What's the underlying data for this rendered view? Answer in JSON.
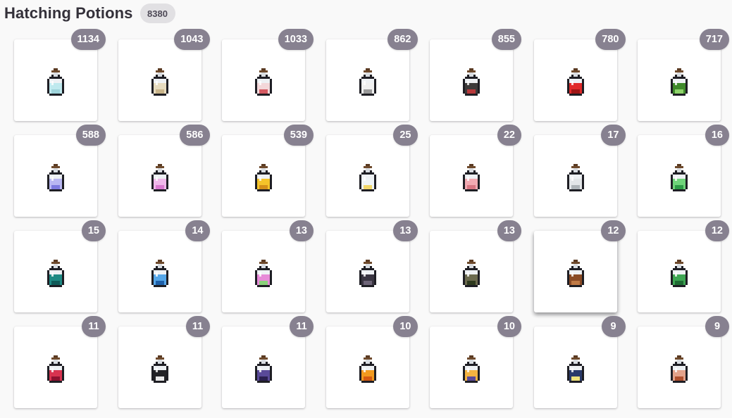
{
  "header": {
    "title": "Hatching Potions",
    "total": "8380"
  },
  "items": [
    {
      "count": "1134",
      "icon": "base-potion-icon",
      "color": "#bfe9ee",
      "accent": "#9ed3da"
    },
    {
      "count": "1043",
      "icon": "desert-potion-icon",
      "color": "#e6dbbf",
      "accent": "#c9b58a"
    },
    {
      "count": "1033",
      "icon": "red-white-potion-icon",
      "color": "#f3d7d9",
      "accent": "#d55a62"
    },
    {
      "count": "862",
      "icon": "skeleton-potion-icon",
      "color": "#f0f0f0",
      "accent": "#9a9a9a"
    },
    {
      "count": "855",
      "icon": "zombie-potion-icon",
      "color": "#3d3a3a",
      "accent": "#b8393b"
    },
    {
      "count": "780",
      "icon": "red-potion-icon",
      "color": "#e02a2a",
      "accent": "#9f1515"
    },
    {
      "count": "717",
      "icon": "cactus-potion-icon",
      "color": "#3f8a2b",
      "accent": "#8ed46a"
    },
    {
      "count": "588",
      "icon": "cotton-candy-blue-potion-icon",
      "color": "#b9b7f2",
      "accent": "#7e7ae0"
    },
    {
      "count": "586",
      "icon": "cotton-candy-pink-potion-icon",
      "color": "#f0b8ea",
      "accent": "#d97ad0"
    },
    {
      "count": "539",
      "icon": "golden-potion-icon",
      "color": "#f5c42a",
      "accent": "#d4901a"
    },
    {
      "count": "25",
      "icon": "rainbow-potion-icon",
      "color": "#eef4f6",
      "accent": "#f0d66a"
    },
    {
      "count": "22",
      "icon": "peppermint-potion-icon",
      "color": "#f2aab2",
      "accent": "#d87783"
    },
    {
      "count": "17",
      "icon": "frost-potion-icon",
      "color": "#e3e6e8",
      "accent": "#aeb4b8"
    },
    {
      "count": "16",
      "icon": "ghost-potion-icon",
      "color": "#6fd47a",
      "accent": "#2e9b47"
    },
    {
      "count": "15",
      "icon": "aquatic-potion-icon",
      "color": "#1e8a84",
      "accent": "#0f5a58"
    },
    {
      "count": "14",
      "icon": "celestial-potion-icon",
      "color": "#55a6e8",
      "accent": "#1d5fa8"
    },
    {
      "count": "13",
      "icon": "glass-potion-icon",
      "color": "#e78ad8",
      "accent": "#8ad27a"
    },
    {
      "count": "13",
      "icon": "shadow-potion-icon",
      "color": "#3a3542",
      "accent": "#6d6477"
    },
    {
      "count": "13",
      "icon": "moss-potion-icon",
      "color": "#6b6a4e",
      "accent": "#2e3a1e"
    },
    {
      "count": "12",
      "icon": "bronze-potion-icon",
      "color": "#8a4b25",
      "accent": "#c07a45"
    },
    {
      "count": "12",
      "icon": "slime-potion-icon",
      "color": "#3ea653",
      "accent": "#1e6b33"
    },
    {
      "count": "11",
      "icon": "ruby-potion-icon",
      "color": "#d83350",
      "accent": "#8f1230"
    },
    {
      "count": "11",
      "icon": "thunderstorm-potion-icon",
      "color": "#222226",
      "accent": "#e9e9ea"
    },
    {
      "count": "11",
      "icon": "vampire-potion-icon",
      "color": "#5a4a99",
      "accent": "#2b2050"
    },
    {
      "count": "10",
      "icon": "fire-potion-icon",
      "color": "#f29a1e",
      "accent": "#d55a12"
    },
    {
      "count": "10",
      "icon": "sunshine-potion-icon",
      "color": "#f4b341",
      "accent": "#5a4a99"
    },
    {
      "count": "9",
      "icon": "cosmic-potion-icon",
      "color": "#2a3a6a",
      "accent": "#f0e27a"
    },
    {
      "count": "9",
      "icon": "copper-potion-icon",
      "color": "#e3a28a",
      "accent": "#b0502e"
    }
  ]
}
